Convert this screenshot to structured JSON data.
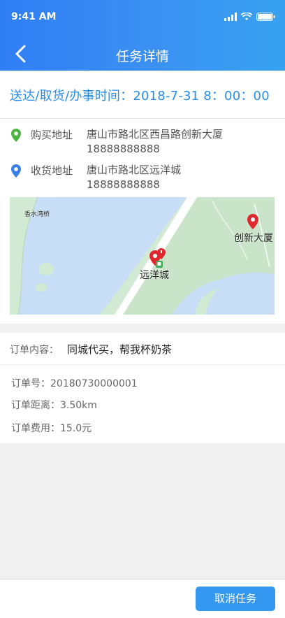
{
  "status_bar": {
    "time": "9:41 AM"
  },
  "header": {
    "title": "任务详情"
  },
  "time_line": "送达/取货/办事时间：2018-7-31 8：00：00",
  "addresses": [
    {
      "label": "购买地址",
      "address": "唐山市路北区西昌路创新大厦",
      "phone": "18888888888",
      "pin_color": "#4ab640"
    },
    {
      "label": "收货地址",
      "address": "唐山市路北区远洋城",
      "phone": "18888888888",
      "pin_color": "#3b7ee8"
    }
  ],
  "map": {
    "labels": {
      "bridge": "香水湾桥",
      "yuanyang": "远洋城",
      "chuangxin": "创新大厦"
    }
  },
  "order": {
    "content_label": "订单内容：",
    "content_value": "同城代买，帮我杯奶茶",
    "number_text": "订单号：20180730000001",
    "distance_text": "订单距离：3.50km",
    "fee_text": "订单费用：15.0元"
  },
  "actions": {
    "cancel_label": "取消任务"
  }
}
